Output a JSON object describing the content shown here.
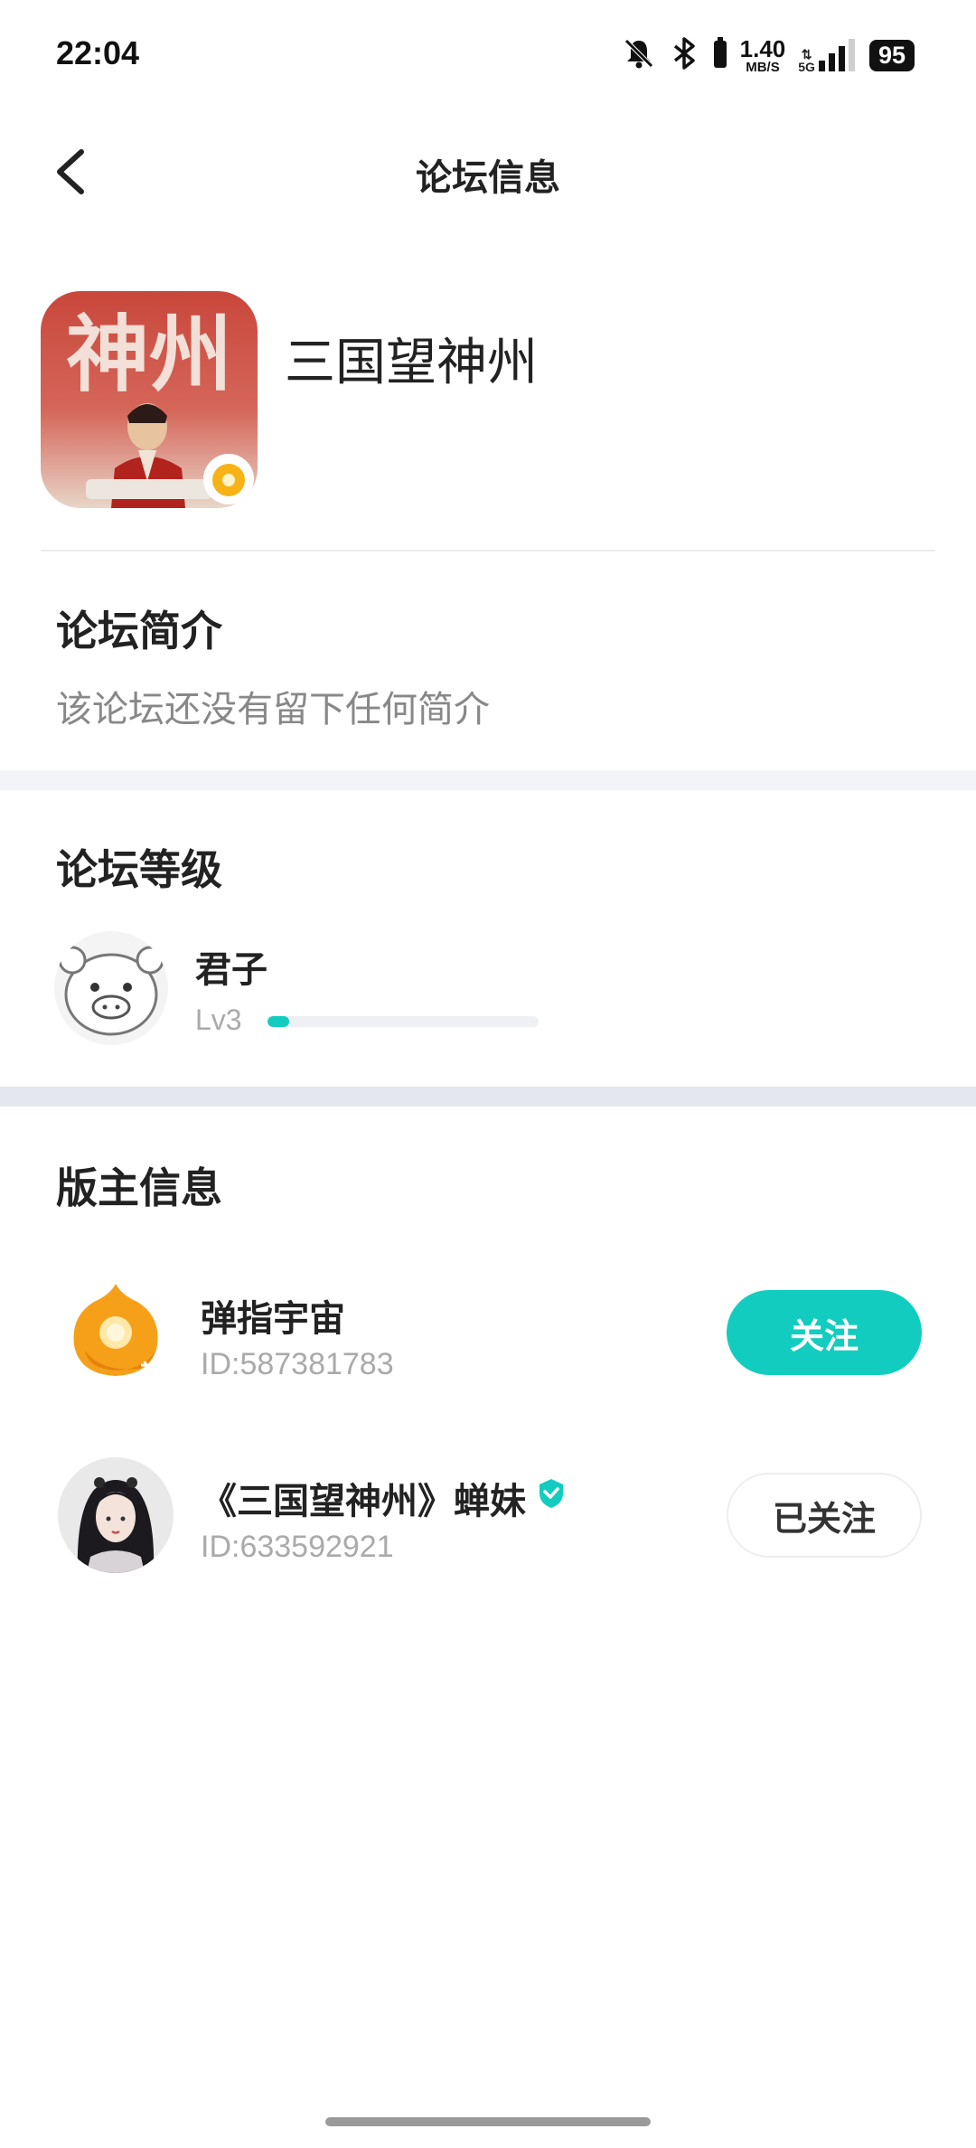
{
  "status_bar": {
    "time": "22:04",
    "net_speed_value": "1.40",
    "net_speed_unit": "MB/S",
    "network": "5G",
    "battery": "95",
    "icons": [
      "mute-bell-icon",
      "bluetooth-icon",
      "signal-icon"
    ]
  },
  "nav": {
    "title": "论坛信息",
    "back_icon": "chevron-left-icon"
  },
  "forum": {
    "name": "三国望神州",
    "avatar_text": "神州"
  },
  "intro": {
    "title": "论坛简介",
    "text": "该论坛还没有留下任何简介"
  },
  "level": {
    "title": "论坛等级",
    "name": "君子",
    "lv": "Lv3",
    "progress": 0.08
  },
  "moderators": {
    "title": "版主信息",
    "items": [
      {
        "name": "弹指宇宙",
        "id": "ID:587381783",
        "button": "关注",
        "verified": false
      },
      {
        "name": "《三国望神州》蝉妹",
        "id": "ID:633592921",
        "button": "已关注",
        "verified": true
      }
    ]
  },
  "colors": {
    "accent": "#12cdbf",
    "band": "#f2f4f7"
  }
}
